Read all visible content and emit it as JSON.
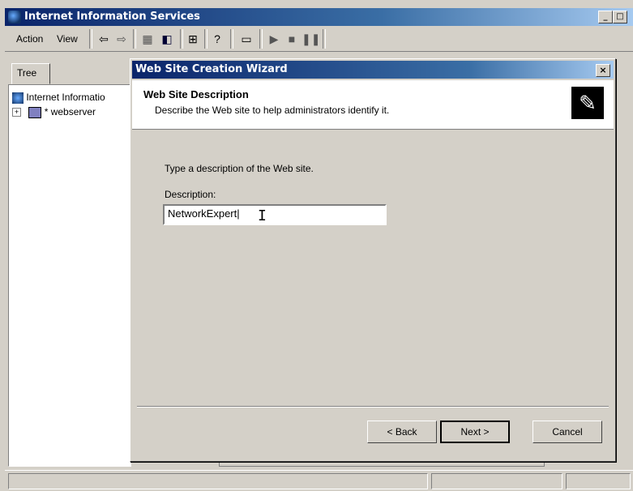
{
  "main_window": {
    "title": "Internet Information Services",
    "controls": {
      "minimize": "_",
      "maximize": "□"
    }
  },
  "menu": {
    "action": "Action",
    "view": "View"
  },
  "toolbar": {
    "icons": [
      "back-arrow-icon",
      "forward-arrow-icon",
      "folder-icon",
      "show-hide-tree-icon",
      "export-list-icon",
      "help-icon",
      "computer-icon",
      "play-icon",
      "stop-icon",
      "pause-icon"
    ]
  },
  "tree": {
    "tab_label": "Tree",
    "root_label": "Internet Informatio",
    "server_label": "* webserver"
  },
  "wizard": {
    "title": "Web Site Creation Wizard",
    "close": "×",
    "header_title": "Web Site Description",
    "header_subtitle": "Describe the Web site to help administrators identify it.",
    "prompt": "Type a description of the Web site.",
    "description_label": "Description:",
    "description_value": "NetworkExpert|",
    "back_label": "< Back",
    "next_label": "Next >",
    "cancel_label": "Cancel"
  }
}
